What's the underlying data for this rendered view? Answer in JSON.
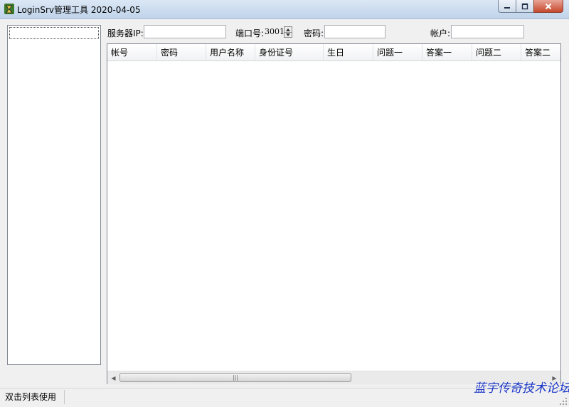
{
  "window": {
    "title": "LoginSrv管理工具 2020-04-05"
  },
  "form": {
    "server_ip_label": "服务器IP:",
    "server_ip_value": "",
    "port_label": "端口号:",
    "port_value": "3001",
    "password_label": "密码:",
    "password_value": "",
    "account_label": "帐户:",
    "account_value": ""
  },
  "list": {
    "columns": [
      "帐号",
      "密码",
      "用户名称",
      "身份证号",
      "生日",
      "问题一",
      "答案一",
      "问题二",
      "答案二"
    ],
    "rows": []
  },
  "scrollbar": {
    "thumb_grip": "|||"
  },
  "status": {
    "text": "双击列表使用"
  },
  "watermark": {
    "text": "蓝宇传奇技术论坛"
  },
  "icons": {
    "app": "green-app-icon",
    "minimize": "minimize-icon",
    "maximize": "maximize-icon",
    "close": "close-icon"
  }
}
